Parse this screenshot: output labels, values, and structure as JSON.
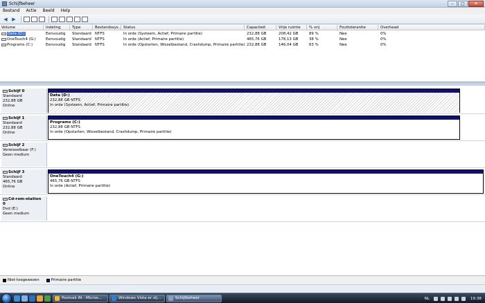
{
  "window": {
    "title": "Schijfbeheer"
  },
  "menu": [
    "Bestand",
    "Actie",
    "Beeld",
    "Help"
  ],
  "volume_table": {
    "columns": [
      "Volume",
      "Indeling",
      "Type",
      "Bestandssys...",
      "Status",
      "Capaciteit",
      "Vrije ruimte",
      "% vrij",
      "Fouttolerantie",
      "Overhead"
    ],
    "rows": [
      [
        "Data (D:)",
        "Eenvoudig",
        "Standaard",
        "NTFS",
        "In orde (Systeem, Actief, Primaire partitie)",
        "232,88 GB",
        "208,42 GB",
        "89 %",
        "Nee",
        "0%"
      ],
      [
        "OneTouch4 (G:)",
        "Eenvoudig",
        "Standaard",
        "NTFS",
        "In orde (Actief, Primaire partitie)",
        "465,76 GB",
        "178,13 GB",
        "38 %",
        "Nee",
        "0%"
      ],
      [
        "Programs (C:)",
        "Eenvoudig",
        "Standaard",
        "NTFS",
        "In orde (Opstarten, Wisselbestand, Crashdump, Primaire partitie)",
        "232,88 GB",
        "146,04 GB",
        "63 %",
        "Nee",
        "0%"
      ]
    ]
  },
  "disks": [
    {
      "name": "Schijf 0",
      "type": "Standaard",
      "size": "232,88 GB",
      "state": "Online",
      "partition": {
        "title": "Data (D:)",
        "size_fs": "232,88 GB NTFS",
        "status": "In orde (Systeem, Actief, Primaire partitie)"
      }
    },
    {
      "name": "Schijf 1",
      "type": "Standaard",
      "size": "232,88 GB",
      "state": "Online",
      "partition": {
        "title": "Programs (C:)",
        "size_fs": "232,88 GB NTFS",
        "status": "In orde (Opstarten, Wisselbestand, Crashdump, Primaire partitie)"
      }
    },
    {
      "name": "Schijf 2",
      "type": "Verwisselbaar (F:)",
      "state": "Geen medium"
    },
    {
      "name": "Schijf 3",
      "type": "Standaard",
      "size": "465,76 GB",
      "state": "Online",
      "partition": {
        "title": "OneTouch4 (G:)",
        "size_fs": "465,76 GB NTFS",
        "status": "In orde (Actief, Primaire partitie)"
      }
    },
    {
      "name": "Cd-rom-station 0",
      "type": "Dvd (E:)",
      "state": "Geen medium"
    }
  ],
  "legend": [
    {
      "label": "Niet-toegewezen",
      "color": "#000000"
    },
    {
      "label": "Primaire partitie",
      "color": "#10106e"
    }
  ],
  "taskbar": {
    "buttons": [
      {
        "label": "Postvak IN - Micros...",
        "icon_color": "#f2b632"
      },
      {
        "label": "Windows Vista er zij...",
        "icon_color": "#2f7fd6"
      },
      {
        "label": "Schijfbeheer",
        "icon_color": "#8aa1bd"
      }
    ],
    "language": "NL",
    "clock": "19:38"
  },
  "colors": {
    "primary_partition": "#10106e",
    "selection": "#3a6ec9"
  }
}
